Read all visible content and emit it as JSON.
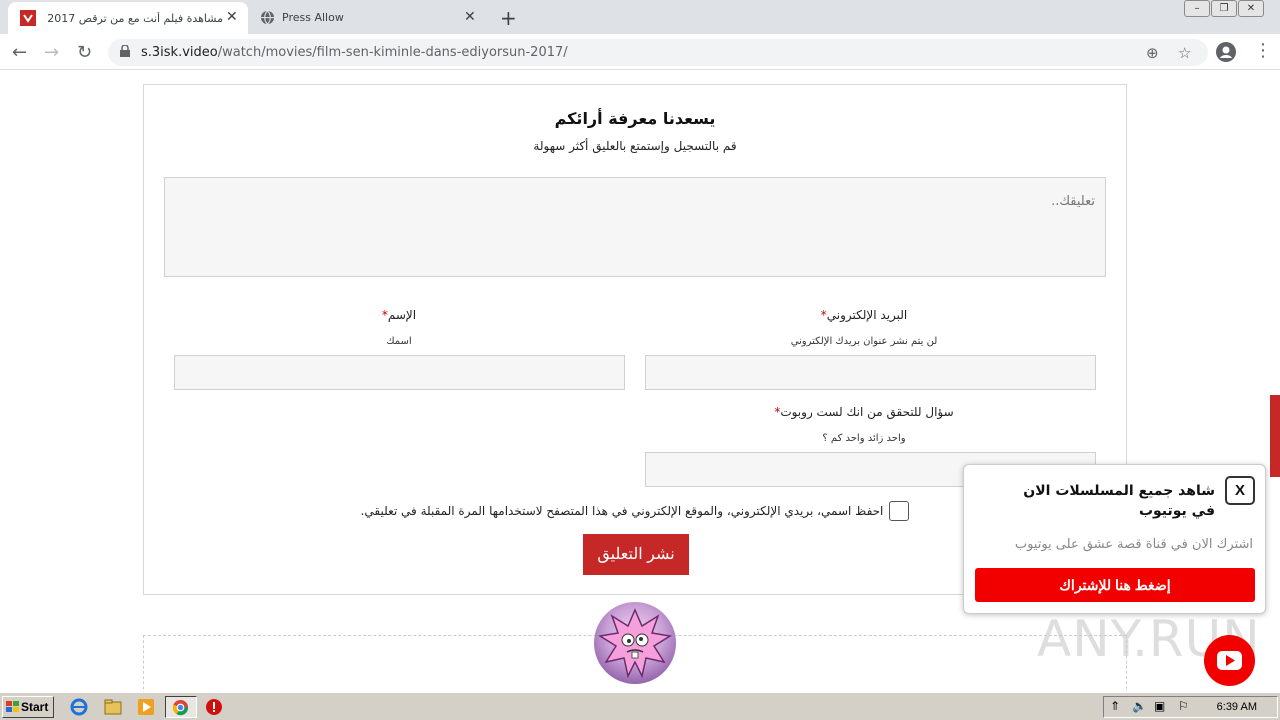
{
  "browser": {
    "tabs": [
      {
        "title": "مشاهدة فيلم أنت مع من ترقص 2017",
        "active": true
      },
      {
        "title": "Press Allow",
        "active": false
      }
    ],
    "new_tab_label": "+",
    "url_host": "s.3isk.video",
    "url_path": "/watch/movies/film-sen-kiminle-dans-ediyorsun-2017/",
    "win_controls": [
      "–",
      "❐",
      "✕"
    ]
  },
  "comment_form": {
    "title": "يسعدنا معرفة أرائكم",
    "subtitle": "قم بالتسجيل وإستمتع بالعليق أكثر سهولة",
    "textarea_placeholder": "تعليقك..",
    "email_label": "البريد الإلكتروني",
    "email_hint": "لن يتم نشر عنوان بريدك الإلكتروني",
    "name_label": "الإسم",
    "name_hint": "اسمك",
    "captcha_label": "سؤال للتحقق من انك لست روبوت",
    "captcha_hint": "واحد زائد واحد كم ؟",
    "required_mark": "*",
    "remember_text": "احفظ اسمي، بريدي الإلكتروني، والموقع الإلكتروني في هذا المتصفح لاستخدامها المرة المقبلة في تعليقي.",
    "submit_label": "نشر التعليق"
  },
  "youtube_popup": {
    "close_label": "X",
    "title": "شاهد جميع المسلسلات الان في يوتيوب",
    "subtitle": "اشترك الان في قناة قصة عشق على يوتيوب",
    "button_label": "إضغط هنا للإشتراك"
  },
  "watermark": "ANY.RUN",
  "taskbar": {
    "start_label": "Start",
    "clock": "6:39 AM"
  },
  "colors": {
    "accent_red": "#c62828",
    "youtube_red": "#f20000"
  }
}
